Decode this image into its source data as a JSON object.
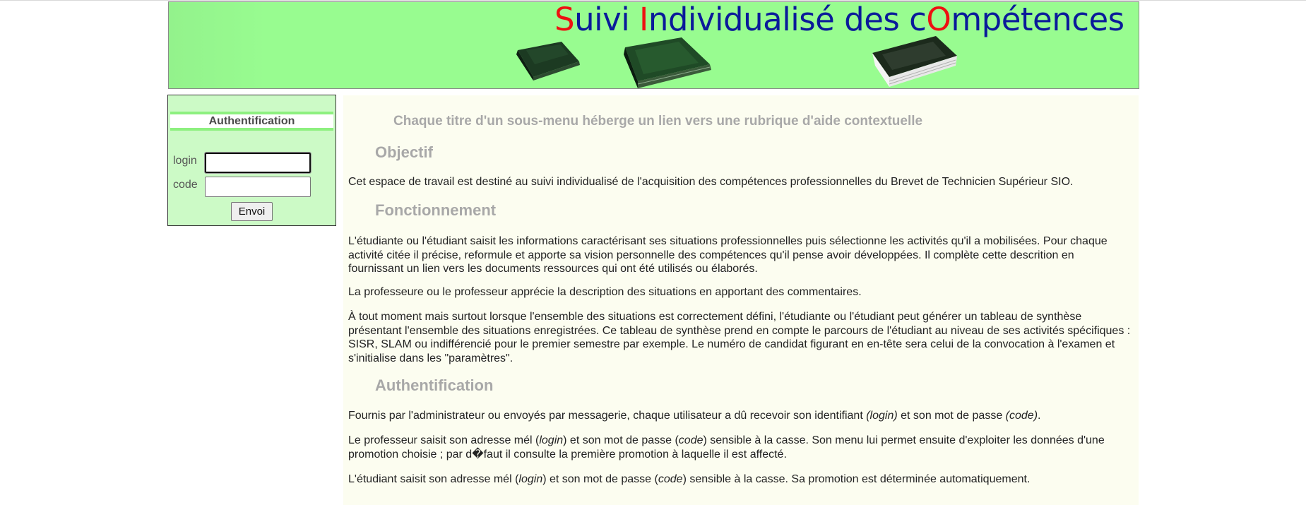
{
  "banner": {
    "title_parts": [
      {
        "text": "S",
        "red": true
      },
      {
        "text": "uivi ",
        "red": false
      },
      {
        "text": "I",
        "red": true
      },
      {
        "text": "ndividualisé des c",
        "red": false
      },
      {
        "text": "O",
        "red": true
      },
      {
        "text": "mpétences",
        "red": false
      }
    ]
  },
  "login": {
    "heading": "Authentification",
    "login_label": "login",
    "code_label": "code",
    "login_value": "",
    "code_value": "",
    "submit_label": "Envoi"
  },
  "content": {
    "intro": "Chaque titre d'un sous-menu héberge un lien vers une rubrique d'aide contextuelle",
    "objectif": {
      "heading": "Objectif",
      "text": "Cet espace de travail est destiné au suivi individualisé de l'acquisition des compétences professionnelles du Brevet de Technicien Supérieur SIO."
    },
    "fonctionnement": {
      "heading": "Fonctionnement",
      "p1": "L'étudiante ou l'étudiant saisit les informations caractérisant ses situations professionnelles puis sélectionne les activités qu'il a mobilisées. Pour chaque activité citée il précise, reformule et apporte sa vision personnelle des compétences qu'il pense avoir développées. Il complète cette descrition en fournissant un lien vers les documents ressources qui ont été utilisés ou élaborés.",
      "p2": "La professeure ou le professeur apprécie la description des situations en apportant des commentaires.",
      "p3": "À tout moment mais surtout lorsque l'ensemble des situations est correctement défini, l'étudiante ou l'étudiant peut générer un tableau de synthèse présentant l'ensemble des situations enregistrées. Ce tableau de synthèse prend en compte le parcours de l'étudiant au niveau de ses activités spécifiques : SISR, SLAM ou indifférencié pour le premier semestre par exemple. Le numéro de candidat figurant en en-tête sera celui de la convocation à l'examen et s'initialise dans les \"paramètres\"."
    },
    "authentification": {
      "heading": "Authentification",
      "p1_a": "Fournis par l'administrateur ou envoyés par messagerie, chaque utilisateur a dû recevoir son identifiant ",
      "p1_login": "(login)",
      "p1_b": " et son mot de passe ",
      "p1_code": "(code)",
      "p1_c": ".",
      "p2_a": "Le professeur saisit son adresse mél (",
      "p2_login": "login",
      "p2_b": ") et son mot de passe (",
      "p2_code": "code",
      "p2_c": ") sensible à la casse. Son menu lui permet ensuite d'exploiter les données d'une promotion choisie ; par d�faut il consulte la première promotion à laquelle il est affecté.",
      "p3_a": "L'étudiant saisit son adresse mél (",
      "p3_login": "login",
      "p3_b": ") et son mot de passe (",
      "p3_code": "code",
      "p3_c": ") sensible à la casse. Sa promotion est déterminée automatiquement."
    }
  },
  "colors": {
    "banner_bg": "#98fc90",
    "title_blue": "#0a1a9a",
    "title_red": "#ee1111",
    "login_bg": "#ccfac6",
    "content_bg": "#fcfdf0",
    "heading_gray": "#a8a8a8"
  }
}
